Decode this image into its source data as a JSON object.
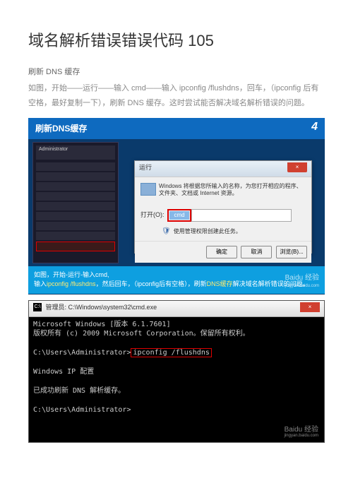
{
  "title": "域名解析错误错误代码 105",
  "intro_line1": "刷新 DNS 缓存",
  "intro_line2": "如图，开始——运行——输入 cmd——输入 ipconfig  /flushdns，回车，（ipconfig 后有空格，最好复制一下），刷新 DNS 缓存。这时尝试能否解决域名解析错误的问题。",
  "fig1": {
    "header": "刷新DNS缓存",
    "step": "4",
    "startmenu_admin": "Administrator",
    "run_title": "运行",
    "run_desc": "Windows 将根据您所输入的名称，为您打开相应的程序、文件夹、文档或 Internet 资源。",
    "open_label": "打开(O):",
    "cmd_text": "cmd",
    "admin_note": "使用管理权限创建此任务。",
    "btn_ok": "确定",
    "btn_cancel": "取消",
    "btn_browse": "浏览(B)...",
    "footer_top": "如图，开始-运行-输入cmd,",
    "footer_bot_prefix": "输入",
    "footer_bot_hl": "ipconfig /flushdns",
    "footer_bot_mid": "，然后回车，（ipconfig后有空格），刷新",
    "footer_bot_hl2": "DNS缓存",
    "footer_bot_suffix": "解决域名解析错误的问题。",
    "watermark_main": "Baidu 经验",
    "watermark_sub": "jingyan.baidu.com"
  },
  "fig2": {
    "title_prefix": "管理员: ",
    "title_path": "C:\\Windows\\system32\\cmd.exe",
    "line1": "Microsoft Windows [版本 6.1.7601]",
    "line2": "版权所有 (c) 2009 Microsoft Corporation。保留所有权利。",
    "prompt1": "C:\\Users\\Administrator>",
    "cmd": "ipconfig /flushdns",
    "line_ipcfg": "Windows IP 配置",
    "line_success": "已成功刷新 DNS 解析缓存。",
    "prompt2": "C:\\Users\\Administrator>",
    "watermark_main": "Baidu 经验",
    "watermark_sub": "jingyan.baidu.com"
  }
}
